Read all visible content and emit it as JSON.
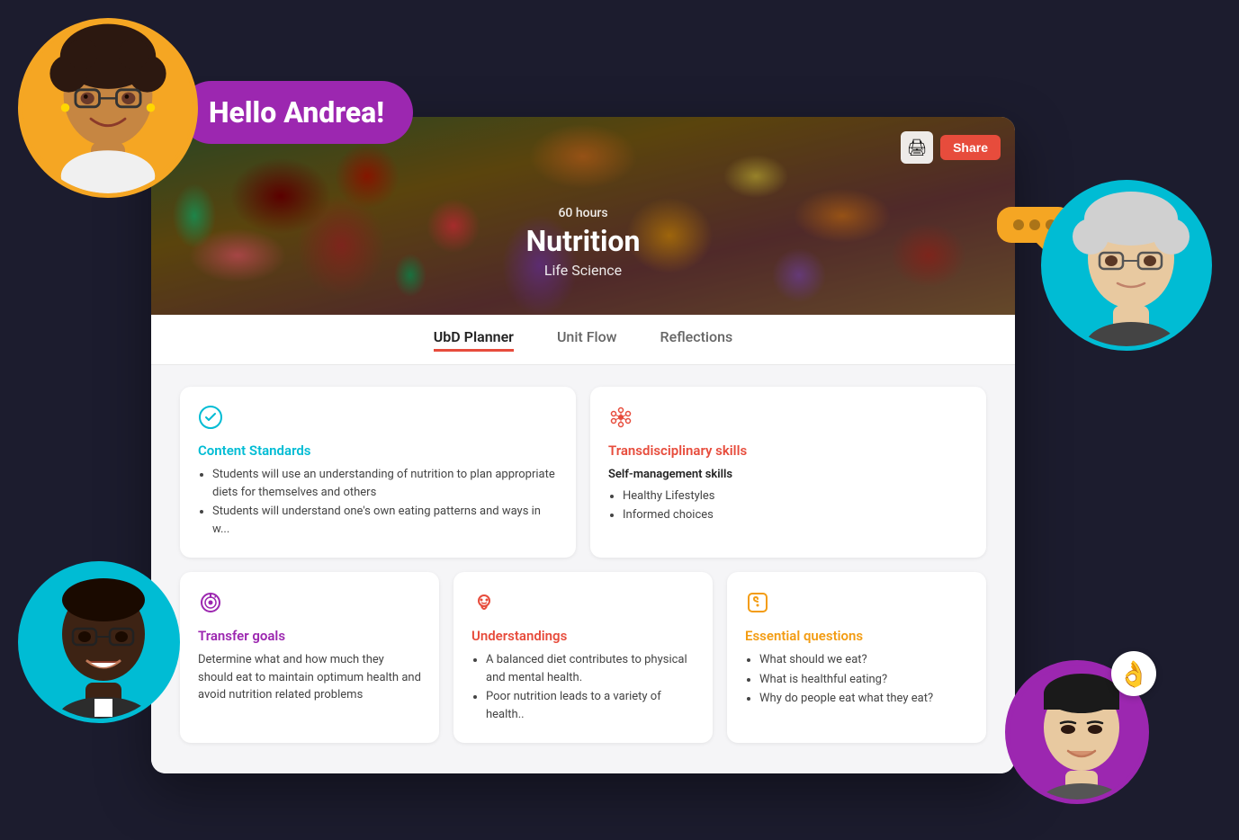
{
  "scene": {
    "background_color": "#1c1c2e"
  },
  "greeting": {
    "text": "Hello Andrea!"
  },
  "hero": {
    "hours": "60 hours",
    "title": "Nutrition",
    "subtitle": "Life Science",
    "print_label": "🖨",
    "share_label": "Share"
  },
  "tabs": [
    {
      "id": "ubd",
      "label": "UbD Planner",
      "active": true
    },
    {
      "id": "unit-flow",
      "label": "Unit Flow",
      "active": false
    },
    {
      "id": "reflections",
      "label": "Reflections",
      "active": false
    }
  ],
  "cards": {
    "content_standards": {
      "title": "Content Standards",
      "icon_color": "#00bcd4",
      "bullets": [
        "Students will use an understanding of nutrition to plan appropriate diets for themselves and others",
        "Students will understand one's own eating patterns and ways in w..."
      ]
    },
    "transdisciplinary": {
      "title": "Transdisciplinary skills",
      "icon_color": "#e74c3c",
      "strong": "Self-management skills",
      "bullets": [
        "Healthy Lifestyles",
        "Informed choices"
      ]
    },
    "transfer_goals": {
      "title": "Transfer goals",
      "icon_color": "#9c27b0",
      "text": "Determine what and how much they should eat to maintain optimum health and avoid nutrition related problems"
    },
    "understandings": {
      "title": "Understandings",
      "icon_color": "#e74c3c",
      "bullets": [
        "A balanced diet contributes to physical and mental health.",
        "Poor nutrition leads to a variety of health.."
      ]
    },
    "essential_questions": {
      "title": "Essential questions",
      "icon_color": "#f39c12",
      "bullets": [
        "What should we eat?",
        "What is healthful eating?",
        "Why do people eat what they eat?"
      ]
    }
  },
  "avatars": {
    "andrea": {
      "emoji": "👩🏽",
      "border_color": "#f5a623"
    },
    "older_woman": {
      "emoji": "👩",
      "border_color": "#00bcd4"
    },
    "man": {
      "emoji": "👨🏿",
      "border_color": "#00bcd4"
    },
    "young_man": {
      "emoji": "👨🏻",
      "border_color": "#9c27b0"
    }
  },
  "chat_bubble": {
    "dots": [
      "•",
      "•",
      "•"
    ]
  },
  "ok_emoji": "👌"
}
